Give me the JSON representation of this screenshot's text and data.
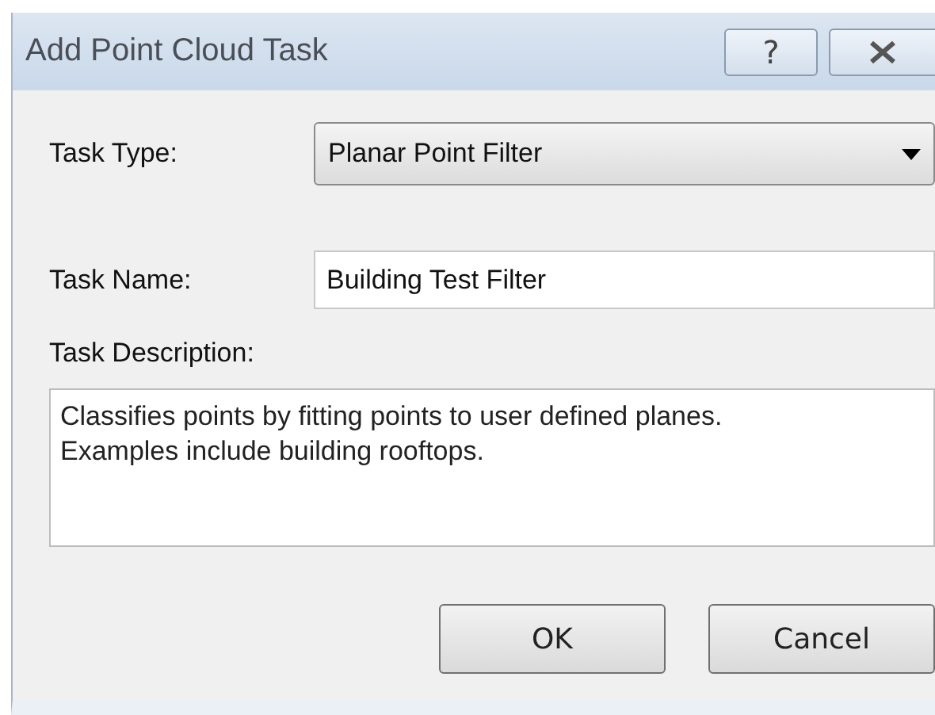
{
  "window": {
    "title": "Add Point Cloud Task",
    "title_buttons": [
      {
        "kind": "help",
        "label": "?"
      },
      {
        "kind": "close"
      }
    ]
  },
  "task_type": {
    "label": "Task Type:",
    "value": "Planar Point Filter"
  },
  "task_name": {
    "label": "Task Name:",
    "value": "Building Test Filter"
  },
  "task_description": {
    "label": "Task Description:",
    "value": "Classifies points by fitting points to user defined planes.\nExamples include building rooftops."
  },
  "buttons": [
    "OK",
    "Cancel"
  ]
}
